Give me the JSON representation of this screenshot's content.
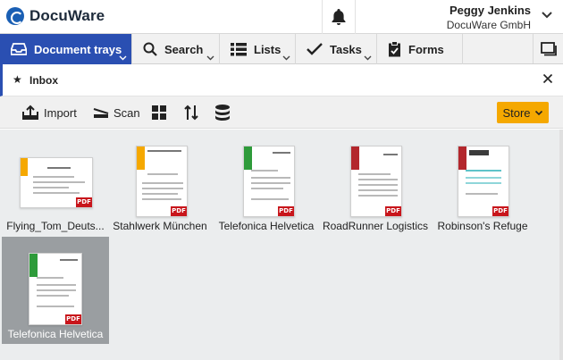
{
  "app": {
    "name": "DocuWare"
  },
  "user": {
    "name": "Peggy Jenkins",
    "company": "DocuWare GmbH"
  },
  "nav": {
    "items": [
      {
        "label": "Document trays",
        "icon": "tray-icon"
      },
      {
        "label": "Search",
        "icon": "search-icon"
      },
      {
        "label": "Lists",
        "icon": "list-icon"
      },
      {
        "label": "Tasks",
        "icon": "check-icon"
      },
      {
        "label": "Forms",
        "icon": "clipboard-icon"
      }
    ]
  },
  "tray": {
    "title": "Inbox"
  },
  "toolbar": {
    "import_label": "Import",
    "scan_label": "Scan",
    "store_label": "Store"
  },
  "documents": [
    {
      "label": "Flying_Tom_Deuts...",
      "band_color": "#f5a800",
      "badge": "PDF",
      "selected": false
    },
    {
      "label": "Stahlwerk München",
      "band_color": "#f5a800",
      "badge": "PDF",
      "selected": false
    },
    {
      "label": "Telefonica Helvetica",
      "band_color": "#2e9b3a",
      "badge": "PDF",
      "selected": false
    },
    {
      "label": "RoadRunner Logistics",
      "band_color": "#b3272d",
      "badge": "PDF",
      "selected": false
    },
    {
      "label": "Robinson's Refuge",
      "band_color": "#b3272d",
      "badge": "PDF",
      "selected": false
    },
    {
      "label": "Telefonica Helvetica",
      "band_color": "#2e9b3a",
      "badge": "PDF",
      "selected": true
    }
  ],
  "colors": {
    "accent": "#2a4fb2",
    "store": "#f5a800",
    "pdf": "#c8151b"
  }
}
